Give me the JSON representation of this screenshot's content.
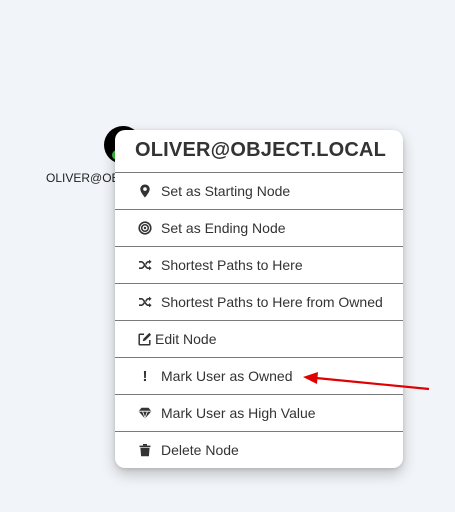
{
  "graph": {
    "node_label": "OLIVER@OBJECT.LOCAL",
    "node_status_color": "#3ec43e"
  },
  "context_menu": {
    "title": "OLIVER@OBJECT.LOCAL",
    "items": [
      {
        "label": "Set as Starting Node",
        "icon": "map-marker-icon"
      },
      {
        "label": "Set as Ending Node",
        "icon": "bullseye-icon"
      },
      {
        "label": "Shortest Paths to Here",
        "icon": "shuffle-icon"
      },
      {
        "label": "Shortest Paths to Here from Owned",
        "icon": "shuffle-icon"
      },
      {
        "label": "Edit Node",
        "icon": "edit-icon"
      },
      {
        "label": "Mark User as Owned",
        "icon": "exclamation-icon"
      },
      {
        "label": "Mark User as High Value",
        "icon": "gem-icon"
      },
      {
        "label": "Delete Node",
        "icon": "trash-icon"
      }
    ]
  },
  "annotation": {
    "arrow_color": "#e00000"
  }
}
